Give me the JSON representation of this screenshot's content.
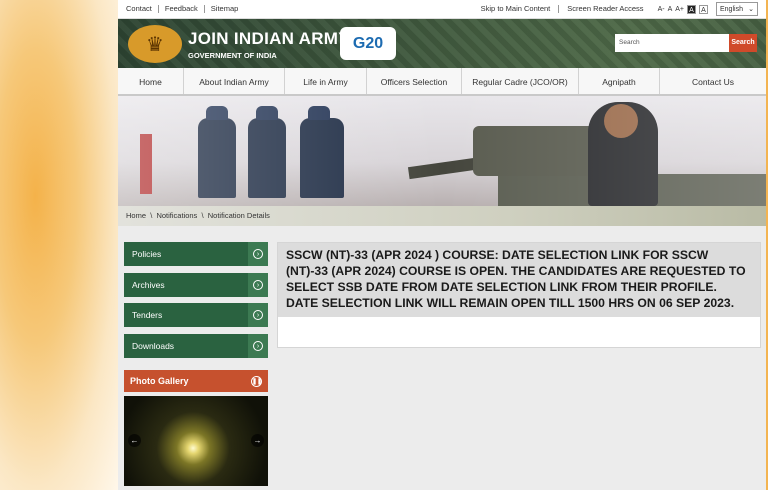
{
  "topbar": {
    "left_links": [
      "Contact",
      "Feedback",
      "Sitemap"
    ],
    "skip_main": "Skip to Main Content",
    "screen_reader": "Screen Reader Access",
    "font_sizes": [
      "A-",
      "A",
      "A+"
    ],
    "contrast": [
      "A",
      "A"
    ],
    "language": "English"
  },
  "header": {
    "title": "JOIN INDIAN ARMY",
    "subtitle": "GOVERNMENT OF INDIA",
    "g20_text": "G20",
    "search_placeholder": "Search",
    "search_button": "Search"
  },
  "nav": [
    "Home",
    "About Indian Army",
    "Life in Army",
    "Officers Selection",
    "Regular Cadre (JCO/OR)",
    "Agnipath",
    "Contact Us"
  ],
  "breadcrumb": [
    "Home",
    "Notifications",
    "Notification Details"
  ],
  "sidebar": [
    "Policies",
    "Archives",
    "Tenders",
    "Downloads"
  ],
  "gallery": {
    "title": "Photo Gallery"
  },
  "notice": {
    "text": "SSCW (NT)-33 (APR 2024 ) COURSE: DATE SELECTION LINK FOR SSCW (NT)-33 (APR 2024) COURSE IS OPEN. THE CANDIDATES ARE REQUESTED TO SELECT SSB DATE FROM DATE SELECTION LINK FROM THEIR PROFILE. DATE SELECTION LINK WILL REMAIN OPEN TILL 1500 HRS ON 06 SEP 2023."
  },
  "colors": {
    "header_green": "#2f4a35",
    "sidebar_green": "#2a6240",
    "accent_orange": "#c6512e",
    "search_red": "#d04a2a"
  }
}
